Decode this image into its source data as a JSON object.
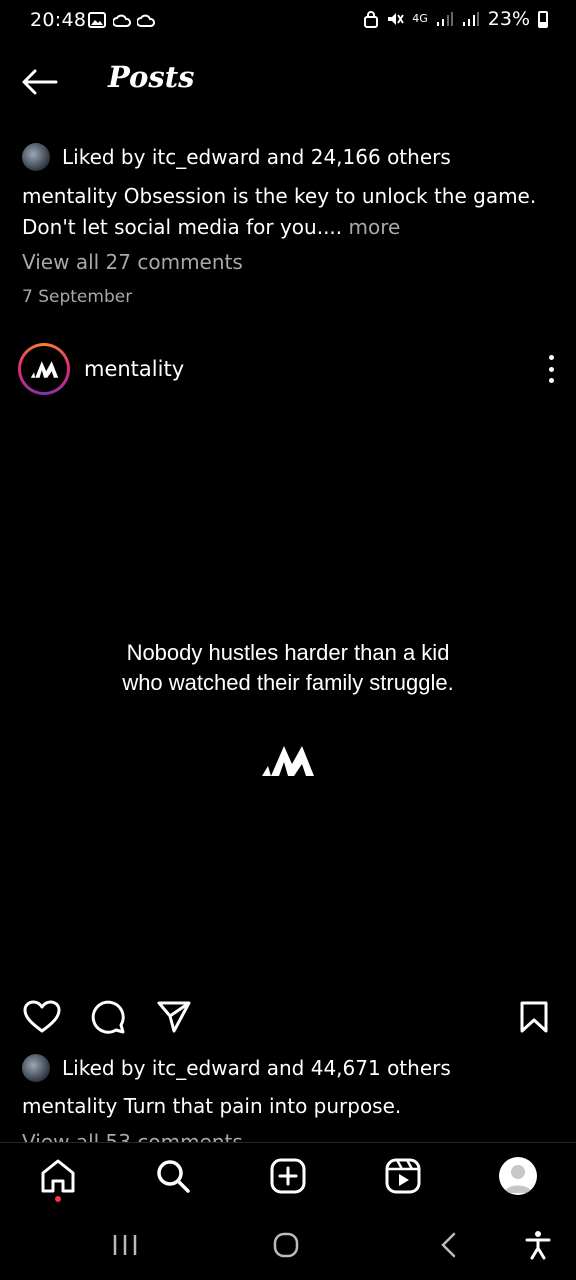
{
  "status_bar": {
    "time": "20:48",
    "network": "4G",
    "battery": "23%",
    "icons": [
      "gallery-icon",
      "cloud-icon",
      "cloud-icon",
      "lock-icon",
      "mute-icon",
      "signal-icon",
      "signal-icon",
      "battery-icon"
    ]
  },
  "header": {
    "title": "Posts",
    "back_icon": "arrow-left-icon"
  },
  "prev_post": {
    "liked_by": "Liked by itc_edward and 24,166 others",
    "caption_user": "mentality",
    "caption_text": " Obsession is the key to unlock the game. Don't let social media for you....",
    "more": " more",
    "view_comments": "View all 27 comments",
    "date": "7 September"
  },
  "post": {
    "username": "mentality",
    "quote_line1": "Nobody hustles harder than a kid",
    "quote_line2": "who watched their family struggle.",
    "liked_by": "Liked by itc_edward and 44,671 others",
    "caption_user": "mentality",
    "caption_text": " Turn that pain into purpose.",
    "view_comments_partial": "View all 53 comments"
  },
  "actions": [
    "heart-icon",
    "comment-icon",
    "share-icon",
    "bookmark-icon"
  ],
  "bottom_nav": [
    "home-icon",
    "search-icon",
    "create-icon",
    "reels-icon",
    "profile-icon"
  ],
  "system_nav": [
    "recents-icon",
    "home-circle-icon",
    "back-icon",
    "accessibility-icon"
  ]
}
